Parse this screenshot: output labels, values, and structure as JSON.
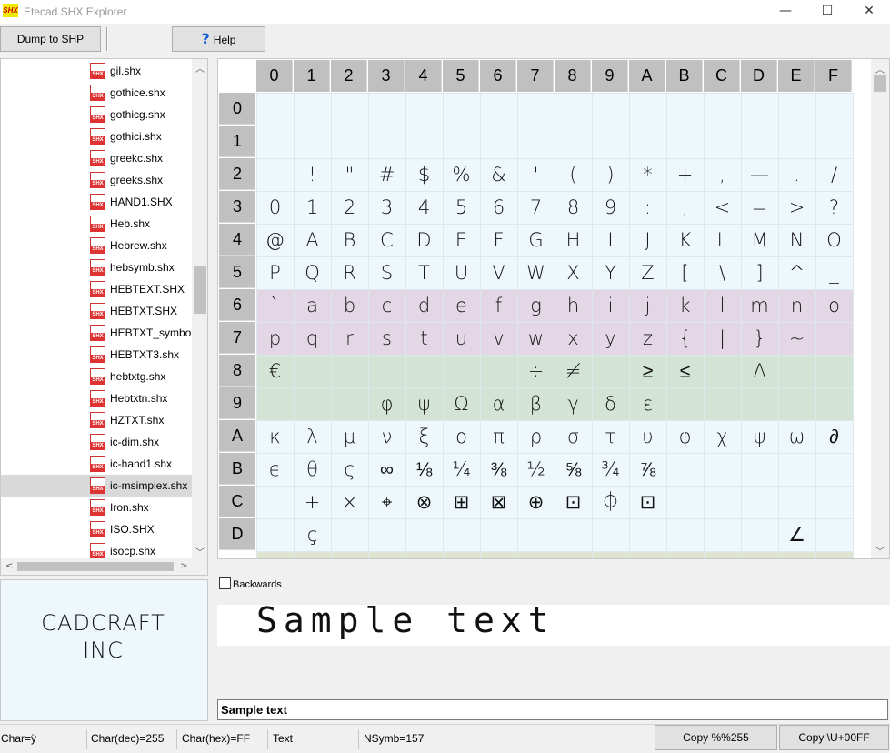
{
  "window": {
    "icon_text": "SHX",
    "title": "Etecad SHX Explorer",
    "minimize": "—",
    "maximize": "☐",
    "close": "✕"
  },
  "toolbar": {
    "dump_label": "Dump to SHP",
    "help_label": "Help",
    "help_glyph": "?"
  },
  "files": {
    "icon_label": "SHX",
    "items": [
      "gil.shx",
      "gothice.shx",
      "gothicg.shx",
      "gothici.shx",
      "greekc.shx",
      "greeks.shx",
      "HAND1.SHX",
      "Heb.shx",
      "Hebrew.shx",
      "hebsymb.shx",
      "HEBTEXT.SHX",
      "HEBTXT.SHX",
      "HEBTXT_symbols",
      "HEBTXT3.shx",
      "hebtxtg.shx",
      "Hebtxtn.shx",
      "HZTXT.shx",
      "ic-dim.shx",
      "ic-hand1.shx",
      "ic-msimplex.shx",
      "Iron.shx",
      "ISO.SHX",
      "isocp.shx"
    ],
    "selected": "ic-msimplex.shx"
  },
  "preview": {
    "line1": "CADCRAFT",
    "line2": "INC"
  },
  "grid": {
    "columns": [
      "0",
      "1",
      "2",
      "3",
      "4",
      "5",
      "6",
      "7",
      "8",
      "9",
      "A",
      "B",
      "C",
      "D",
      "E",
      "F"
    ],
    "rows": [
      "0",
      "1",
      "2",
      "3",
      "4",
      "5",
      "6",
      "7",
      "8",
      "9",
      "A",
      "B",
      "C",
      "D"
    ],
    "row_colors": {
      "default": "#eef8fc",
      "6": "#e3d7e6",
      "7": "#e3d7e6",
      "8": "#d3e3d6",
      "9": "#d3e3d6"
    },
    "glyphs": {
      "2": [
        "",
        "!",
        "\"",
        "#",
        "$",
        "%",
        "&",
        "'",
        "(",
        ")",
        "*",
        "+",
        ",",
        "—",
        ".",
        "/"
      ],
      "3": [
        "0",
        "1",
        "2",
        "3",
        "4",
        "5",
        "6",
        "7",
        "8",
        "9",
        ":",
        ";",
        "<",
        "=",
        ">",
        "?"
      ],
      "4": [
        "@",
        "A",
        "B",
        "C",
        "D",
        "E",
        "F",
        "G",
        "H",
        "I",
        "J",
        "K",
        "L",
        "M",
        "N",
        "O"
      ],
      "5": [
        "P",
        "Q",
        "R",
        "S",
        "T",
        "U",
        "V",
        "W",
        "X",
        "Y",
        "Z",
        "[",
        "\\",
        "]",
        "^",
        "_"
      ],
      "6": [
        "`",
        "a",
        "b",
        "c",
        "d",
        "e",
        "f",
        "g",
        "h",
        "i",
        "j",
        "k",
        "l",
        "m",
        "n",
        "o"
      ],
      "7": [
        "p",
        "q",
        "r",
        "s",
        "t",
        "u",
        "v",
        "w",
        "x",
        "y",
        "z",
        "{",
        "|",
        "}",
        "~",
        ""
      ],
      "8": [
        "€",
        "",
        "",
        "",
        "",
        "",
        "",
        "÷",
        "≠",
        "",
        "≥",
        "≤",
        "",
        "Δ",
        "",
        ""
      ],
      "9": [
        "",
        "",
        "",
        "φ",
        "ψ",
        "Ω",
        "α",
        "β",
        "γ",
        "δ",
        "ε",
        "",
        "",
        "",
        "",
        ""
      ],
      "A": [
        "κ",
        "λ",
        "μ",
        "ν",
        "ξ",
        "ο",
        "π",
        "ρ",
        "σ",
        "τ",
        "υ",
        "φ",
        "χ",
        "ψ",
        "ω",
        "∂"
      ],
      "B": [
        "ϵ",
        "θ",
        "ς",
        "∞",
        "⅛",
        "¼",
        "⅜",
        "½",
        "⅝",
        "¾",
        "⅞",
        "",
        "",
        "",
        "",
        ""
      ],
      "C": [
        "",
        "+",
        "×",
        "⌖",
        "⊗",
        "⊞",
        "⊠",
        "⊕",
        "⊡",
        "⏀",
        "⊡",
        "",
        "",
        "",
        "",
        ""
      ],
      "D": [
        "",
        "ç",
        "",
        "",
        "",
        "",
        "",
        "",
        "",
        "",
        "",
        "",
        "",
        "",
        "∠",
        ""
      ]
    }
  },
  "options": {
    "backwards_label": "Backwards"
  },
  "sample": {
    "rendered": "Sample text",
    "input_value": "Sample text"
  },
  "status": {
    "char": "Char=ÿ",
    "char_dec": "Char(dec)=255",
    "char_hex": "Char(hex)=FF",
    "mode": "Text",
    "nsymb": "NSymb=157",
    "copy_percent": "Copy %%255",
    "copy_unicode": "Copy \\U+00FF"
  }
}
